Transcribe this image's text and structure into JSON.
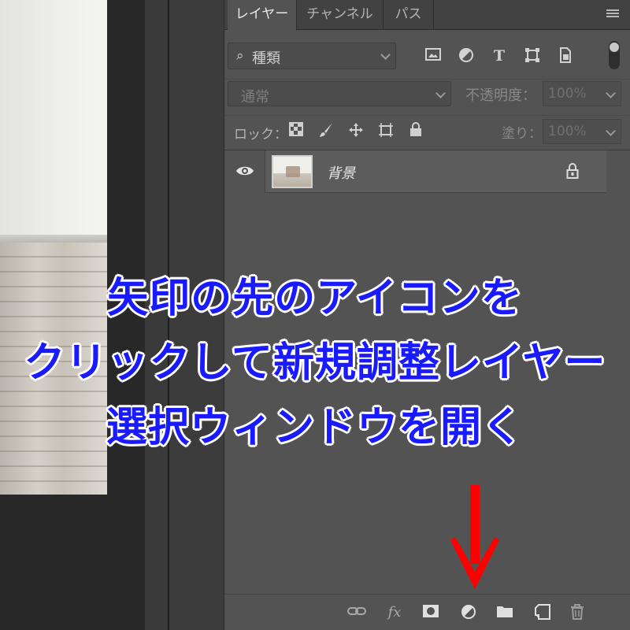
{
  "tabs": {
    "layers": "レイヤー",
    "channels": "チャンネル",
    "paths": "パス"
  },
  "filter": {
    "label": "種類",
    "icons": [
      "image-filter-icon",
      "adjustment-filter-icon",
      "type-filter-icon",
      "shape-filter-icon",
      "smart-object-filter-icon"
    ]
  },
  "blend": {
    "mode": "通常",
    "opacity_label": "不透明度：",
    "opacity_value": "100%"
  },
  "lock": {
    "label": "ロック：",
    "fill_label": "塗り：",
    "fill_value": "100%"
  },
  "layers": [
    {
      "name": "背景",
      "visible": true,
      "locked": true
    }
  ],
  "bottom_toolbar": [
    "link-layers-icon",
    "fx-icon",
    "add-mask-icon",
    "new-adjustment-layer-icon",
    "new-group-icon",
    "new-layer-icon",
    "delete-layer-icon"
  ],
  "fx_label": "fx",
  "caption": {
    "line1": "矢印の先のアイコンを",
    "line2": "クリックして新規調整レイヤー",
    "line3": "選択ウィンドウを開く"
  },
  "colors": {
    "caption": "#1a1aff",
    "arrow": "#ff0000",
    "panel": "#535353"
  }
}
